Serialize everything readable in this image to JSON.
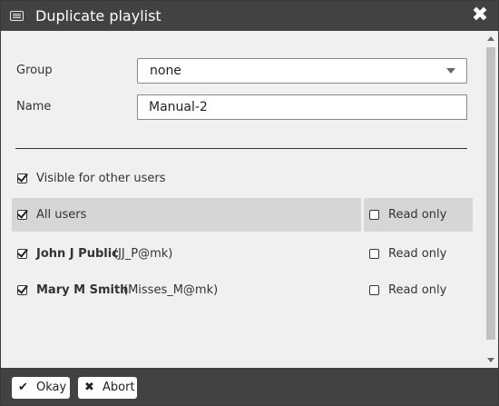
{
  "dialog": {
    "title": "Duplicate playlist",
    "title_icon": "list-window-icon",
    "close_icon": "close-icon"
  },
  "form": {
    "group_label": "Group",
    "group_value": "none",
    "name_label": "Name",
    "name_value": "Manual-2"
  },
  "sharing": {
    "visible_label": "Visible for other users",
    "visible_checked": true,
    "all_users_label": "All users",
    "all_users_checked": true,
    "all_users_readonly_label": "Read only",
    "all_users_readonly_checked": false,
    "users": [
      {
        "name": "John J Public",
        "handle": "(JJ_P@mk)",
        "checked": true,
        "readonly_label": "Read only",
        "readonly_checked": false
      },
      {
        "name": "Mary M Smith",
        "handle": "(Misses_M@mk)",
        "checked": true,
        "readonly_label": "Read only",
        "readonly_checked": false
      }
    ]
  },
  "footer": {
    "okay_label": "Okay",
    "okay_icon": "check-icon",
    "abort_label": "Abort",
    "abort_icon": "x-icon"
  },
  "colors": {
    "titlebar": "#424242",
    "content_bg": "#f0f0f0",
    "highlight_row": "#d6d6d6"
  }
}
